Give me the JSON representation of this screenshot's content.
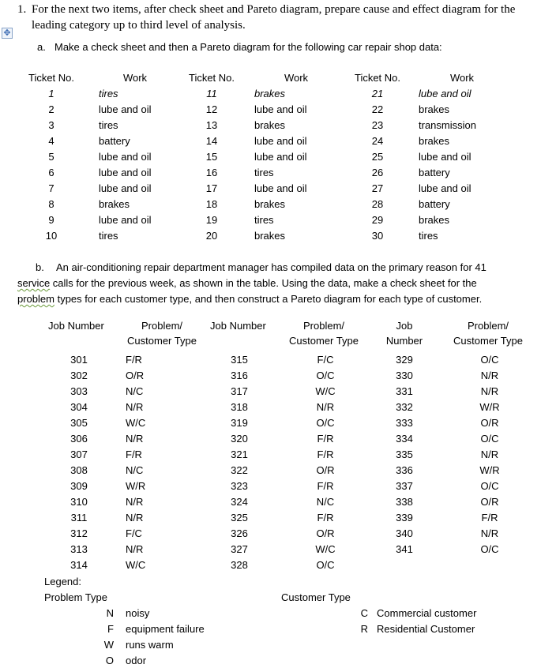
{
  "question": {
    "number": "1.",
    "line1": "For the next two items, after check sheet and Pareto diagram, prepare cause and effect diagram for the",
    "line2": "leading category up to third level of analysis."
  },
  "part_a": {
    "label": "a.",
    "text": "Make a check sheet and then a Pareto diagram for the following car repair shop data:",
    "headers": [
      "Ticket No.",
      "Work",
      "Ticket No.",
      "Work",
      "Ticket No.",
      "Work"
    ],
    "columns": [
      [
        {
          "ticket": "1",
          "work": "tires"
        },
        {
          "ticket": "2",
          "work": "lube and oil"
        },
        {
          "ticket": "3",
          "work": "tires"
        },
        {
          "ticket": "4",
          "work": "battery"
        },
        {
          "ticket": "5",
          "work": "lube and oil"
        },
        {
          "ticket": "6",
          "work": "lube and oil"
        },
        {
          "ticket": "7",
          "work": "lube and oil"
        },
        {
          "ticket": "8",
          "work": "brakes"
        },
        {
          "ticket": "9",
          "work": "lube and oil"
        },
        {
          "ticket": "10",
          "work": "tires"
        }
      ],
      [
        {
          "ticket": "11",
          "work": "brakes"
        },
        {
          "ticket": "12",
          "work": "lube and oil"
        },
        {
          "ticket": "13",
          "work": "brakes"
        },
        {
          "ticket": "14",
          "work": "lube and oil"
        },
        {
          "ticket": "15",
          "work": "lube and oil"
        },
        {
          "ticket": "16",
          "work": "tires"
        },
        {
          "ticket": "17",
          "work": "lube and oil"
        },
        {
          "ticket": "18",
          "work": "brakes"
        },
        {
          "ticket": "19",
          "work": "tires"
        },
        {
          "ticket": "20",
          "work": "brakes"
        }
      ],
      [
        {
          "ticket": "21",
          "work": "lube and oil"
        },
        {
          "ticket": "22",
          "work": "brakes"
        },
        {
          "ticket": "23",
          "work": "transmission"
        },
        {
          "ticket": "24",
          "work": "brakes"
        },
        {
          "ticket": "25",
          "work": "lube and oil"
        },
        {
          "ticket": "26",
          "work": "battery"
        },
        {
          "ticket": "27",
          "work": "lube and oil"
        },
        {
          "ticket": "28",
          "work": "battery"
        },
        {
          "ticket": "29",
          "work": "brakes"
        },
        {
          "ticket": "30",
          "work": "tires"
        }
      ]
    ]
  },
  "part_b": {
    "label": "b.",
    "line1": "An air-conditioning repair department manager has compiled data on the primary reason for 41",
    "line2_word": "service",
    "line2_rest": " calls for the previous week, as shown in the table. Using the data, make a check sheet for the",
    "line3_word": "problem",
    "line3_rest": " types for each customer type, and then construct a Pareto diagram for each type of customer.",
    "headers": {
      "job1": "Job Number",
      "prob1_a": "Problem/",
      "prob1_b": "Customer Type",
      "job2": "Job Number",
      "prob2_a": "Problem/",
      "prob2_b": "Customer Type",
      "job3_a": "Job",
      "job3_b": "Number",
      "prob3_a": "Problem/",
      "prob3_b": "Customer Type"
    },
    "columns": [
      [
        {
          "job": "301",
          "code": "F/R"
        },
        {
          "job": "302",
          "code": "O/R"
        },
        {
          "job": "303",
          "code": "N/C"
        },
        {
          "job": "304",
          "code": "N/R"
        },
        {
          "job": "305",
          "code": "W/C"
        },
        {
          "job": "306",
          "code": "N/R"
        },
        {
          "job": "307",
          "code": "F/R"
        },
        {
          "job": "308",
          "code": "N/C"
        },
        {
          "job": "309",
          "code": "W/R"
        },
        {
          "job": "310",
          "code": "N/R"
        },
        {
          "job": "311",
          "code": "N/R"
        },
        {
          "job": "312",
          "code": "F/C"
        },
        {
          "job": "313",
          "code": "N/R"
        },
        {
          "job": "314",
          "code": "W/C"
        }
      ],
      [
        {
          "job": "315",
          "code": "F/C"
        },
        {
          "job": "316",
          "code": "O/C"
        },
        {
          "job": "317",
          "code": "W/C"
        },
        {
          "job": "318",
          "code": "N/R"
        },
        {
          "job": "319",
          "code": "O/C"
        },
        {
          "job": "320",
          "code": "F/R"
        },
        {
          "job": "321",
          "code": "F/R"
        },
        {
          "job": "322",
          "code": "O/R"
        },
        {
          "job": "323",
          "code": "F/R"
        },
        {
          "job": "324",
          "code": "N/C"
        },
        {
          "job": "325",
          "code": "F/R"
        },
        {
          "job": "326",
          "code": "O/R"
        },
        {
          "job": "327",
          "code": "W/C"
        },
        {
          "job": "328",
          "code": "O/C"
        }
      ],
      [
        {
          "job": "329",
          "code": "O/C"
        },
        {
          "job": "330",
          "code": "N/R"
        },
        {
          "job": "331",
          "code": "N/R"
        },
        {
          "job": "332",
          "code": "W/R"
        },
        {
          "job": "333",
          "code": "O/R"
        },
        {
          "job": "334",
          "code": "O/C"
        },
        {
          "job": "335",
          "code": "N/R"
        },
        {
          "job": "336",
          "code": "W/R"
        },
        {
          "job": "337",
          "code": "O/C"
        },
        {
          "job": "338",
          "code": "O/R"
        },
        {
          "job": "339",
          "code": "F/R"
        },
        {
          "job": "340",
          "code": "N/R"
        },
        {
          "job": "341",
          "code": "O/C"
        }
      ]
    ]
  },
  "legend": {
    "title": "Legend:",
    "problem_title": "Problem Type",
    "customer_title": "Customer Type",
    "problems": [
      {
        "code": "N",
        "desc": "noisy"
      },
      {
        "code": "F",
        "desc": "equipment failure"
      },
      {
        "code": "W",
        "desc": "runs warm"
      },
      {
        "code": "O",
        "desc": "odor"
      }
    ],
    "customers": [
      {
        "code": "C",
        "desc": "Commercial customer"
      },
      {
        "code": "R",
        "desc": "Residential Customer"
      }
    ]
  }
}
